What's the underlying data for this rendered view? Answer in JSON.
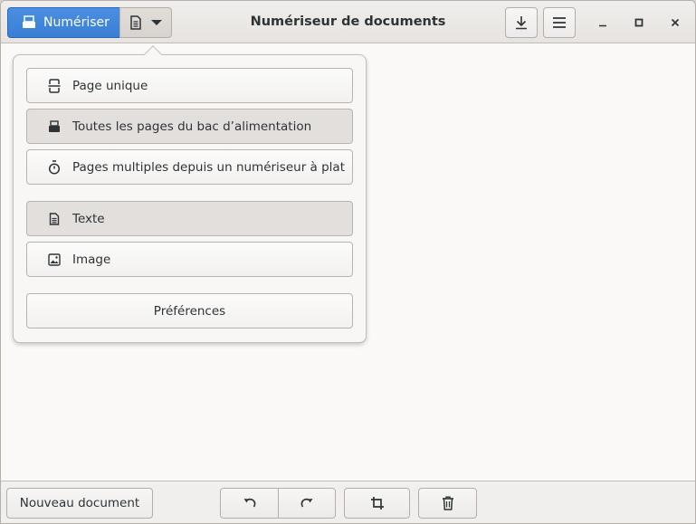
{
  "header": {
    "title": "Numériseur de documents",
    "scan_label": "Numériser",
    "scan_type_icon": "document-icon",
    "save_icon": "download-icon",
    "menu_icon": "hamburger-icon"
  },
  "window_controls": {
    "minimize_icon": "minimize-icon",
    "maximize_icon": "maximize-icon",
    "close_icon": "close-icon"
  },
  "popover": {
    "scan_modes": [
      {
        "label": "Page unique",
        "icon": "single-page-icon",
        "selected": false
      },
      {
        "label": "Toutes les pages du bac d’alimentation",
        "icon": "feeder-icon",
        "selected": true
      },
      {
        "label": "Pages multiples depuis un numériseur à plat",
        "icon": "timer-icon",
        "selected": false
      }
    ],
    "document_types": [
      {
        "label": "Texte",
        "icon": "text-document-icon",
        "selected": true
      },
      {
        "label": "Image",
        "icon": "image-icon",
        "selected": false
      }
    ],
    "preferences_label": "Préférences"
  },
  "bottom": {
    "new_document_label": "Nouveau document",
    "rotate_left_icon": "rotate-left-icon",
    "rotate_right_icon": "rotate-right-icon",
    "crop_icon": "crop-icon",
    "delete_icon": "trash-icon"
  },
  "colors": {
    "accent": "#3a7fd5",
    "window_bg": "#faf9f8",
    "selected_item_bg": "#e2dfdc"
  }
}
